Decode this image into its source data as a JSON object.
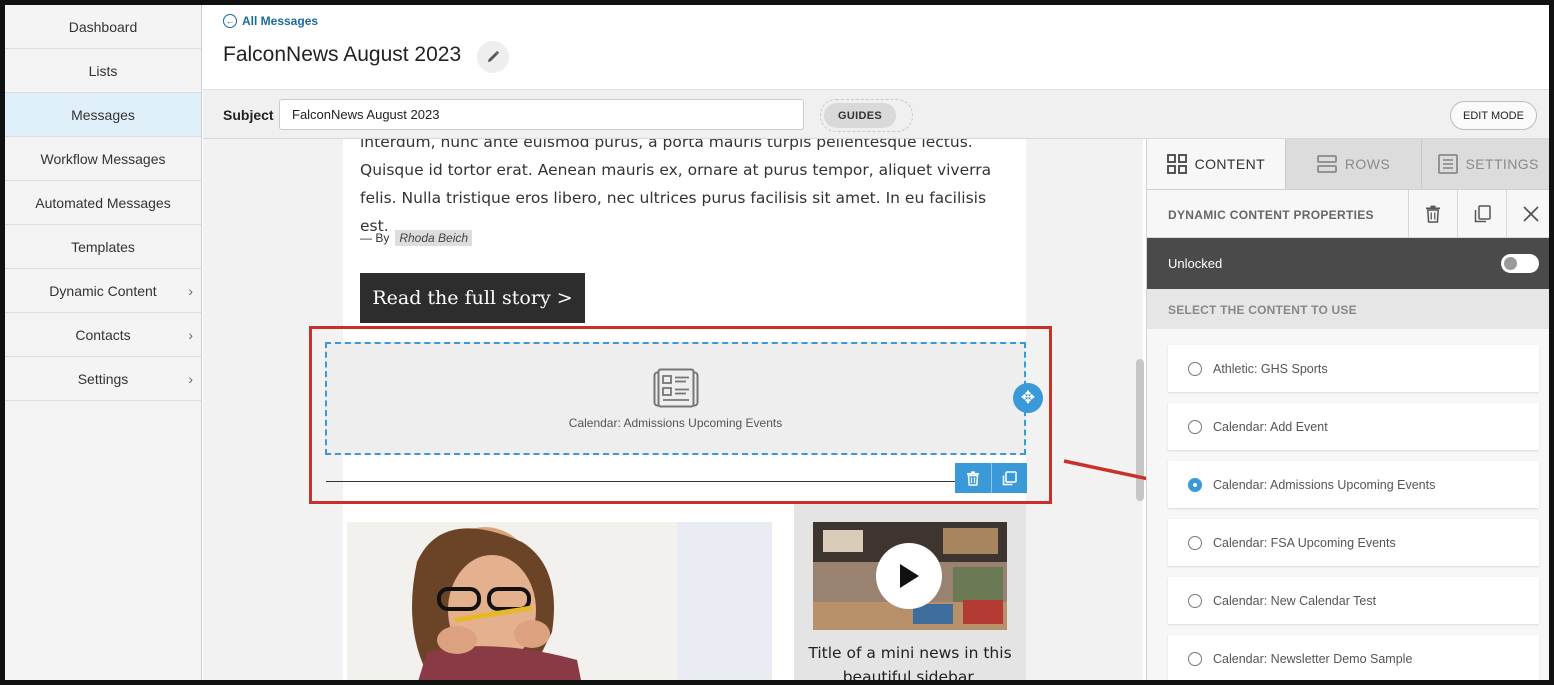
{
  "sidebar": {
    "items": [
      {
        "label": "Dashboard"
      },
      {
        "label": "Lists"
      },
      {
        "label": "Messages"
      },
      {
        "label": "Workflow Messages"
      },
      {
        "label": "Automated Messages"
      },
      {
        "label": "Templates"
      },
      {
        "label": "Dynamic Content"
      },
      {
        "label": "Contacts"
      },
      {
        "label": "Settings"
      }
    ]
  },
  "header": {
    "back_label": "All Messages",
    "title": "FalconNews August 2023"
  },
  "subject": {
    "label": "Subject",
    "value": "FalconNews August 2023",
    "guides_label": "GUIDES",
    "edit_mode_label": "EDIT MODE"
  },
  "email": {
    "body_text": "interdum, nunc ante euismod purus, a porta mauris turpis pellentesque lectus. Quisque id tortor erat. Aenean mauris ex, ornare at purus tempor, aliquet viverra felis. Nulla tristique eros libero, nec ultrices purus facilisis sit amet. In eu facilisis est.",
    "byline_prefix": "— By",
    "author": "Rhoda Beich",
    "cta_label": "Read the full story >",
    "dynamic_block_label": "Calendar: Admissions Upcoming Events",
    "sidebar_card_title": "Title of a mini news in this beautiful sidebar."
  },
  "panel": {
    "tabs": [
      {
        "label": "CONTENT"
      },
      {
        "label": "ROWS"
      },
      {
        "label": "SETTINGS"
      }
    ],
    "properties_title": "DYNAMIC CONTENT PROPERTIES",
    "lock_label": "Unlocked",
    "select_title": "SELECT THE CONTENT TO USE",
    "options": [
      {
        "label": "Athletic: GHS Sports"
      },
      {
        "label": "Calendar: Add Event"
      },
      {
        "label": "Calendar: Admissions Upcoming Events"
      },
      {
        "label": "Calendar: FSA Upcoming Events"
      },
      {
        "label": "Calendar: New Calendar Test"
      },
      {
        "label": "Calendar: Newsletter Demo Sample"
      }
    ],
    "selected_option": "Calendar: Admissions Upcoming Events"
  },
  "colors": {
    "accent": "#3a9ad9",
    "highlight": "#c9302c",
    "active_nav": "#dff0fb"
  }
}
